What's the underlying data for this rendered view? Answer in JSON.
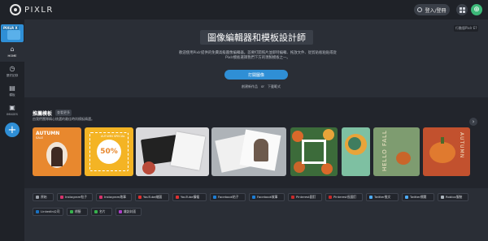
{
  "app": {
    "brand": "PIXLR"
  },
  "topbar": {
    "login_label": "登入/登冊"
  },
  "sidebar": {
    "logo_tag": "PIXLR X",
    "items": [
      {
        "label": "HOME",
        "icon": "home-icon",
        "glyph": "⌂"
      },
      {
        "label": "歷史記錄",
        "icon": "history-icon",
        "glyph": "◷"
      },
      {
        "label": "模板",
        "icon": "templates-icon",
        "glyph": "▤"
      },
      {
        "label": "IMAGES",
        "icon": "images-icon",
        "glyph": "▣"
      }
    ],
    "add_label": "+"
  },
  "hero": {
    "version": "行動版Pixlr E?",
    "title": "圖像編輯器和模板設計師",
    "description": "歡迎使用Pixlr提供的免費高級圖像編輯器。首要打開照片並即時編輯、拖放文件、從剪貼板粘貼或從Pixlr模板選擇我們下方的現製模板之一。",
    "open_button": "打開圖像",
    "create_link": "創建新作品",
    "or_label": "or",
    "load_link": "下載",
    "load_link2": "範式"
  },
  "templates": {
    "title": "推薦模板",
    "view_all": "查看更多",
    "description": "由我們團隊精心挑選的最佳時尚模板精選。",
    "cards": [
      {
        "title": "AUTUMN",
        "subtitle": "SALE"
      },
      {
        "label": "AUTUMN SPECIAL",
        "value": "50%"
      },
      {
        "label": ""
      },
      {
        "label": ""
      },
      {
        "label": ""
      },
      {
        "label": ""
      },
      {
        "text": "HELLO FALL"
      },
      {
        "text": "AUTUMN"
      }
    ]
  },
  "chips": [
    {
      "label": "原始",
      "color": "#9aa0a8"
    },
    {
      "label": "Instagram帖子",
      "color": "#d6336c"
    },
    {
      "label": "Instagram故事",
      "color": "#d6336c"
    },
    {
      "label": "YouTube縮圖",
      "color": "#e03131"
    },
    {
      "label": "YouTube橫幅",
      "color": "#e03131"
    },
    {
      "label": "Facebook帖子",
      "color": "#1c7ed6"
    },
    {
      "label": "Facebook故事",
      "color": "#1c7ed6"
    },
    {
      "label": "Pinterest圖釘",
      "color": "#c92a2a"
    },
    {
      "label": "Pinterest長圖釘",
      "color": "#c92a2a"
    },
    {
      "label": "Twitter推文",
      "color": "#4dabf7"
    },
    {
      "label": "Twitter標題",
      "color": "#4dabf7"
    },
    {
      "label": "Roblox服裝",
      "color": "#adb5bd"
    },
    {
      "label": "LinkedIn公司",
      "color": "#1971c2"
    },
    {
      "label": "標籤",
      "color": "#37b24d"
    },
    {
      "label": "名片",
      "color": "#37b24d"
    },
    {
      "label": "雜誌封面",
      "color": "#ae3ec9"
    }
  ]
}
